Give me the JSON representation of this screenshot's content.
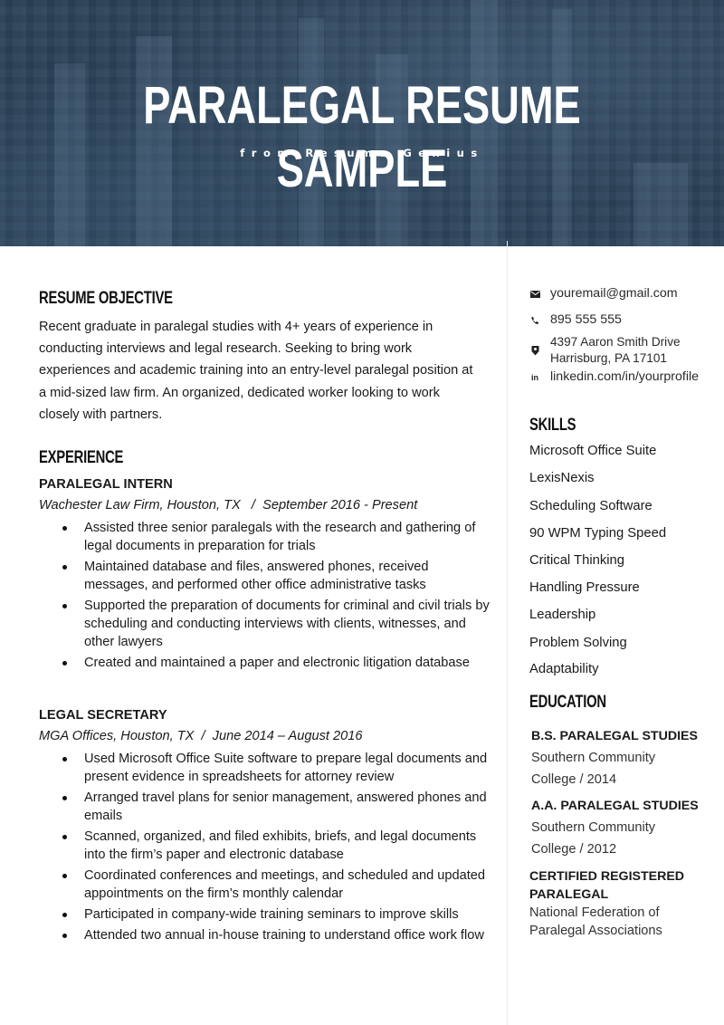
{
  "header": {
    "title": "PARALEGAL RESUME SAMPLE",
    "subtitle": "from Resume Genius",
    "background_color": "#2c4258"
  },
  "main": {
    "objective": {
      "heading": "RESUME OBJECTIVE",
      "text": "Recent graduate in paralegal studies with 4+ years of experience in conducting interviews and legal research. Seeking to bring work experiences and academic training into an entry-level paralegal position at a mid-sized law firm. An organized, dedicated worker looking to work closely with partners."
    },
    "experience": {
      "heading": "EXPERIENCE",
      "jobs": [
        {
          "title": "PARALEGAL INTERN",
          "meta": "Wachester Law Firm, Houston, TX   /  September 2016 - Present",
          "bullets": [
            "Assisted three senior paralegals with the research and gathering of legal documents in preparation for trials",
            "Maintained database and files, answered phones, received messages, and performed other office administrative tasks",
            "Supported the preparation of documents for criminal and civil trials by scheduling and conducting interviews with clients, witnesses, and other lawyers",
            "Created and maintained a paper and electronic litigation database"
          ]
        },
        {
          "title": "LEGAL SECRETARY",
          "meta": "MGA Offices, Houston, TX  /  June 2014 – August 2016",
          "bullets": [
            "Used Microsoft Office Suite software to prepare legal documents and present evidence in spreadsheets for attorney review",
            "Arranged travel plans for senior management, answered phones and emails",
            "Scanned, organized, and filed exhibits, briefs, and legal documents into the firm’s paper and electronic database",
            "Coordinated conferences and meetings, and scheduled and updated appointments on the firm’s monthly calendar",
            "Participated in company-wide training seminars to improve skills",
            "Attended two annual in-house training to understand office work flow"
          ]
        }
      ]
    }
  },
  "sidebar": {
    "contact": {
      "email": {
        "icon": "envelope-icon",
        "value": "youremail@gmail.com"
      },
      "phone": {
        "icon": "phone-icon",
        "value": "895 555 555"
      },
      "address": {
        "icon": "map-pin-icon",
        "line1": "4397 Aaron Smith Drive",
        "line2": "Harrisburg, PA 17101"
      },
      "linkedin": {
        "icon": "linkedin-icon",
        "glyph": "in",
        "value": "linkedin.com/in/yourprofile"
      }
    },
    "skills": {
      "heading": "SKILLS",
      "items": [
        "Microsoft Office Suite",
        "LexisNexis",
        "Scheduling Software",
        "90 WPM Typing Speed",
        "Critical Thinking",
        "Handling Pressure",
        "Leadership",
        "Problem Solving",
        "Adaptability"
      ]
    },
    "education": {
      "heading": "EDUCATION",
      "entries": [
        {
          "degree": "B.S. PARALEGAL STUDIES",
          "school": "Southern Community\nCollege  /  2014"
        },
        {
          "degree": "A.A. PARALEGAL STUDIES",
          "school": "Southern Community\nCollege  /  2012"
        }
      ],
      "certification": {
        "title": "CERTIFIED REGISTERED PARALEGAL",
        "org": "National Federation of Paralegal Associations"
      }
    }
  }
}
